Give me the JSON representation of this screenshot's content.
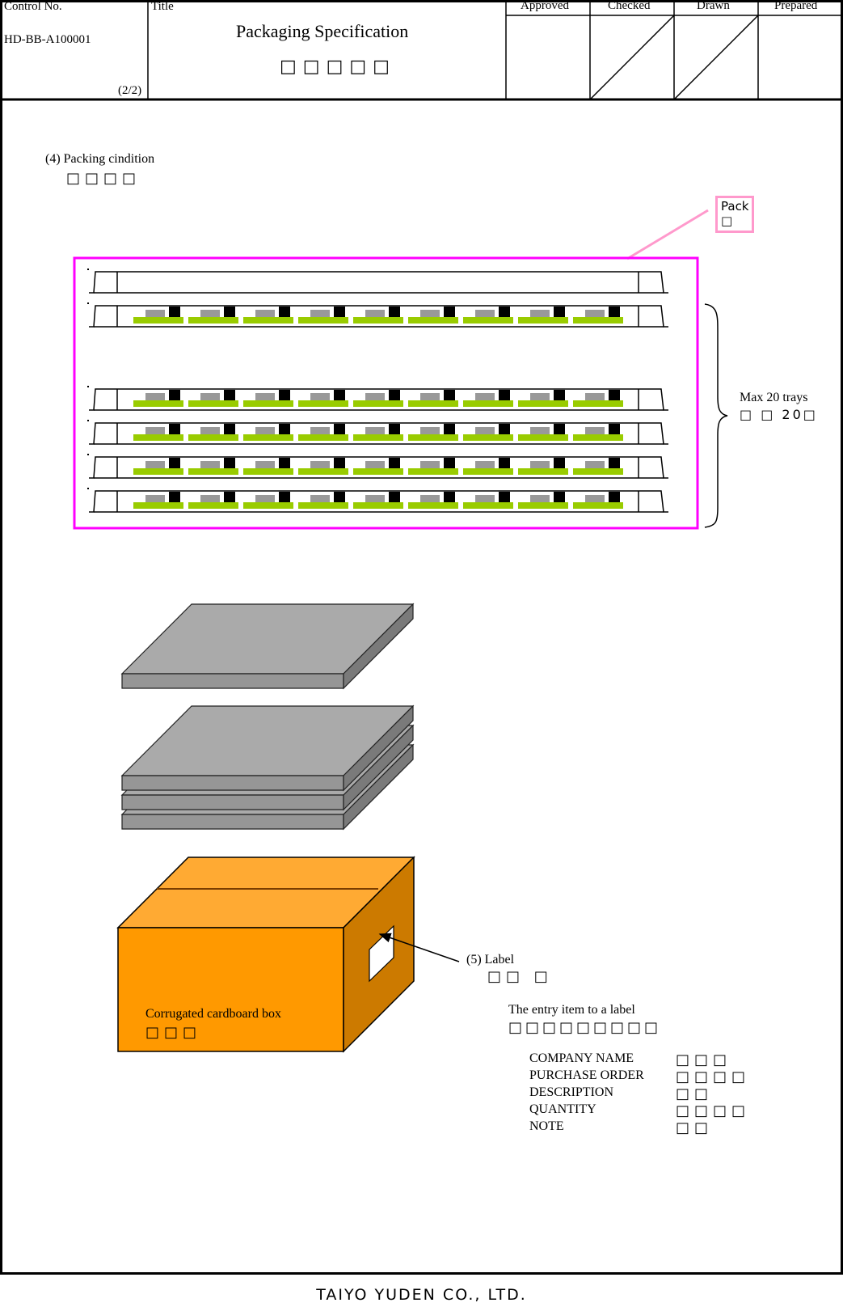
{
  "header": {
    "control_no_label": "Control No.",
    "control_no_value": "HD-BB-A100001",
    "page": "(2/2)",
    "title_label": "Title",
    "title_en": "Packaging Specification",
    "title_jp": "□□□□□",
    "approvals": [
      "Approved",
      "Checked",
      "Drawn",
      "Prepared"
    ],
    "slashed_cells": [
      "Checked",
      "Drawn"
    ]
  },
  "section4": {
    "heading": "(4) Packing cindition",
    "heading_jp": "□□□□"
  },
  "callout": {
    "text": "Pack",
    "text_jp": "□"
  },
  "tray_stack": {
    "max_label": "Max 20 trays",
    "max_label_jp": "□ □ 20□",
    "visible_trays": 6,
    "empty_top_tray": true,
    "components_per_tray": 9
  },
  "box": {
    "label": "Corrugated cardboard box",
    "label_jp": "□□□"
  },
  "section5": {
    "heading": "(5) Label",
    "heading_jp": "□□ □",
    "entry_title": "The entry item to a label",
    "entry_title_jp": "□□□□□□□□□",
    "items": [
      {
        "en": "COMPANY NAME",
        "jp": "□□□"
      },
      {
        "en": "PURCHASE ORDER",
        "jp": "□□□□"
      },
      {
        "en": "DESCRIPTION",
        "jp": "□□"
      },
      {
        "en": "QUANTITY",
        "jp": "□□□□"
      },
      {
        "en": "NOTE",
        "jp": "□□"
      }
    ]
  },
  "footer": {
    "company": "TAIYO YUDEN CO., LTD."
  },
  "colors": {
    "frame_magenta": "#ff00ff",
    "callout_pink": "#ff99cc",
    "component_green": "#99cc00",
    "component_gray": "#999999",
    "sheet_gray_top": "#aaaaaa",
    "sheet_gray_side": "#808080",
    "box_front": "#ff9900",
    "box_top": "#ffaa33",
    "box_side": "#cc7a00"
  }
}
